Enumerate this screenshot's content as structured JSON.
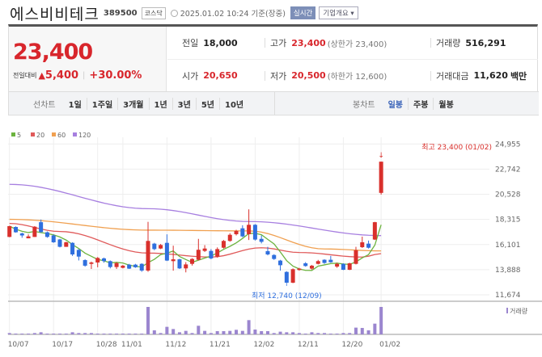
{
  "header": {
    "name": "에스비비테크",
    "code": "389500",
    "market": "코스닥",
    "datetime": "2025.01.02 10:24 기준(장중)",
    "realtime": "실시간",
    "company_overview": "기업개요"
  },
  "quote": {
    "price": "23,400",
    "change_label": "전일대비",
    "change": "5,400",
    "change_pct": "+30.00%",
    "prev_label": "전일",
    "prev": "18,000",
    "high_label": "고가",
    "high": "23,400",
    "upper_limit": "(상한가 23,400)",
    "volume_label": "거래량",
    "volume": "516,291",
    "open_label": "시가",
    "open": "20,650",
    "low_label": "저가",
    "low": "20,500",
    "lower_limit": "(하한가 12,600)",
    "amount_label": "거래대금",
    "amount": "11,620",
    "amount_unit": "백만"
  },
  "tabs": {
    "line_label": "선차트",
    "line": [
      "1일",
      "1주일",
      "3개월",
      "1년",
      "3년",
      "5년",
      "10년"
    ],
    "candle_label": "봉차트",
    "candle": [
      "일봉",
      "주봉",
      "월봉"
    ],
    "active_candle": "일봉"
  },
  "colors": {
    "up": "#d9302c",
    "down": "#2f6fde",
    "ma5": "#6cb33f",
    "ma20": "#e05a5a",
    "ma60": "#f0a050",
    "ma120": "#a77fe0",
    "volume": "#9b86cf"
  },
  "chart_data": {
    "type": "candlestick",
    "legend": [
      "5",
      "20",
      "60",
      "120"
    ],
    "volume_legend": "거래량",
    "ylim": [
      11674,
      24955
    ],
    "yticks": [
      "24,955",
      "22,742",
      "20,528",
      "18,315",
      "16,101",
      "13,888",
      "11,674"
    ],
    "yticks_values": [
      24955,
      22742,
      20528,
      18315,
      16101,
      13888,
      11674
    ],
    "xticks": [
      {
        "label": "10/07",
        "i": 0
      },
      {
        "label": "10/17",
        "i": 7
      },
      {
        "label": "10/28",
        "i": 14
      },
      {
        "label": "11/01",
        "i": 18
      },
      {
        "label": "11/12",
        "i": 25
      },
      {
        "label": "11/21",
        "i": 32
      },
      {
        "label": "12/02",
        "i": 39
      },
      {
        "label": "12/11",
        "i": 46
      },
      {
        "label": "12/20",
        "i": 53
      },
      {
        "label": "01/02",
        "i": 59
      }
    ],
    "high_annotation": "최고 23,400 (01/02)",
    "low_annotation": "최저 12,740 (12/09)",
    "candles": [
      [
        16770,
        17720,
        17750,
        16750
      ],
      [
        17650,
        17180,
        17700,
        17150
      ],
      [
        17080,
        16900,
        17150,
        16700
      ],
      [
        16650,
        16820,
        17000,
        16650
      ],
      [
        16770,
        17670,
        17720,
        16770
      ],
      [
        18070,
        17200,
        18300,
        17150
      ],
      [
        17180,
        16770,
        17250,
        16700
      ],
      [
        16900,
        16300,
        17000,
        16250
      ],
      [
        16550,
        15900,
        16600,
        15850
      ],
      [
        15900,
        16300,
        16350,
        15900
      ],
      [
        16250,
        15230,
        16300,
        15100
      ],
      [
        15630,
        15040,
        15700,
        14700
      ],
      [
        14730,
        14240,
        14800,
        14150
      ],
      [
        14400,
        14520,
        14600,
        13950
      ],
      [
        14520,
        14920,
        15000,
        14100
      ],
      [
        14880,
        14640,
        14950,
        14500
      ],
      [
        14640,
        14120,
        14700,
        14000
      ],
      [
        14120,
        14470,
        14550,
        13950
      ],
      [
        14050,
        14240,
        14300,
        14000
      ],
      [
        14330,
        13980,
        14400,
        13950
      ],
      [
        14330,
        14100,
        14400,
        14050
      ],
      [
        14400,
        13810,
        14450,
        13700
      ],
      [
        13810,
        16420,
        18100,
        13700
      ],
      [
        16180,
        15700,
        16250,
        15600
      ],
      [
        15750,
        16060,
        16150,
        15700
      ],
      [
        16250,
        14690,
        17000,
        14650
      ],
      [
        14640,
        14800,
        16000,
        13800
      ],
      [
        14800,
        14000,
        14850,
        13950
      ],
      [
        14000,
        14350,
        14550,
        13650
      ],
      [
        14400,
        14830,
        14900,
        14250
      ],
      [
        14760,
        15640,
        16600,
        14700
      ],
      [
        15540,
        15750,
        16050,
        15450
      ],
      [
        15540,
        14880,
        15700,
        14800
      ],
      [
        15040,
        15700,
        15850,
        14950
      ],
      [
        15820,
        16420,
        16500,
        15750
      ],
      [
        16420,
        16960,
        17100,
        16350
      ],
      [
        17010,
        17300,
        17400,
        16900
      ],
      [
        17530,
        16820,
        17800,
        16750
      ],
      [
        17010,
        17840,
        19200,
        16500
      ],
      [
        17840,
        16540,
        17900,
        16450
      ],
      [
        16600,
        16340,
        16900,
        16200
      ],
      [
        15520,
        15230,
        15900,
        15150
      ],
      [
        15180,
        14830,
        15250,
        14750
      ],
      [
        14690,
        14280,
        14750,
        13800
      ],
      [
        13690,
        12740,
        13750,
        12740
      ],
      [
        12740,
        13930,
        14000,
        12700
      ],
      [
        13860,
        13980,
        14050,
        13800
      ],
      [
        14450,
        14210,
        14550,
        14150
      ],
      [
        13980,
        14240,
        14300,
        13900
      ],
      [
        14400,
        14640,
        14750,
        14350
      ],
      [
        14760,
        14480,
        14800,
        14400
      ],
      [
        14760,
        14540,
        15100,
        14500
      ],
      [
        14160,
        14400,
        14500,
        14050
      ],
      [
        14400,
        13880,
        14450,
        13850
      ],
      [
        13880,
        14450,
        14500,
        13850
      ],
      [
        14400,
        15600,
        15900,
        14350
      ],
      [
        15870,
        16300,
        16800,
        15800
      ],
      [
        16180,
        15820,
        16450,
        15750
      ],
      [
        16540,
        18070,
        18100,
        16500
      ],
      [
        20650,
        23400,
        23400,
        20500
      ]
    ],
    "candle_fields": [
      "open",
      "close",
      "high",
      "low"
    ],
    "volume_thousands": [
      25,
      15,
      15,
      15,
      25,
      40,
      15,
      15,
      15,
      15,
      40,
      25,
      25,
      25,
      15,
      15,
      15,
      15,
      15,
      15,
      15,
      15,
      516,
      76,
      25,
      142,
      101,
      40,
      66,
      25,
      162,
      66,
      25,
      61,
      61,
      66,
      86,
      66,
      268,
      91,
      61,
      61,
      25,
      51,
      40,
      40,
      25,
      15,
      40,
      25,
      25,
      15,
      15,
      25,
      25,
      127,
      121,
      76,
      202,
      516
    ],
    "ma20": [
      [
        0,
        17960
      ],
      [
        8,
        17250
      ],
      [
        22,
        15350
      ],
      [
        32,
        15000
      ],
      [
        40,
        15820
      ],
      [
        46,
        15400
      ],
      [
        56,
        15000
      ],
      [
        59,
        15300
      ]
    ],
    "ma60": [
      [
        0,
        18320
      ],
      [
        22,
        17370
      ],
      [
        38,
        17300
      ],
      [
        50,
        15710
      ],
      [
        59,
        15540
      ]
    ],
    "ma120": [
      [
        0,
        21400
      ],
      [
        22,
        19260
      ],
      [
        38,
        18130
      ],
      [
        59,
        16890
      ]
    ]
  }
}
